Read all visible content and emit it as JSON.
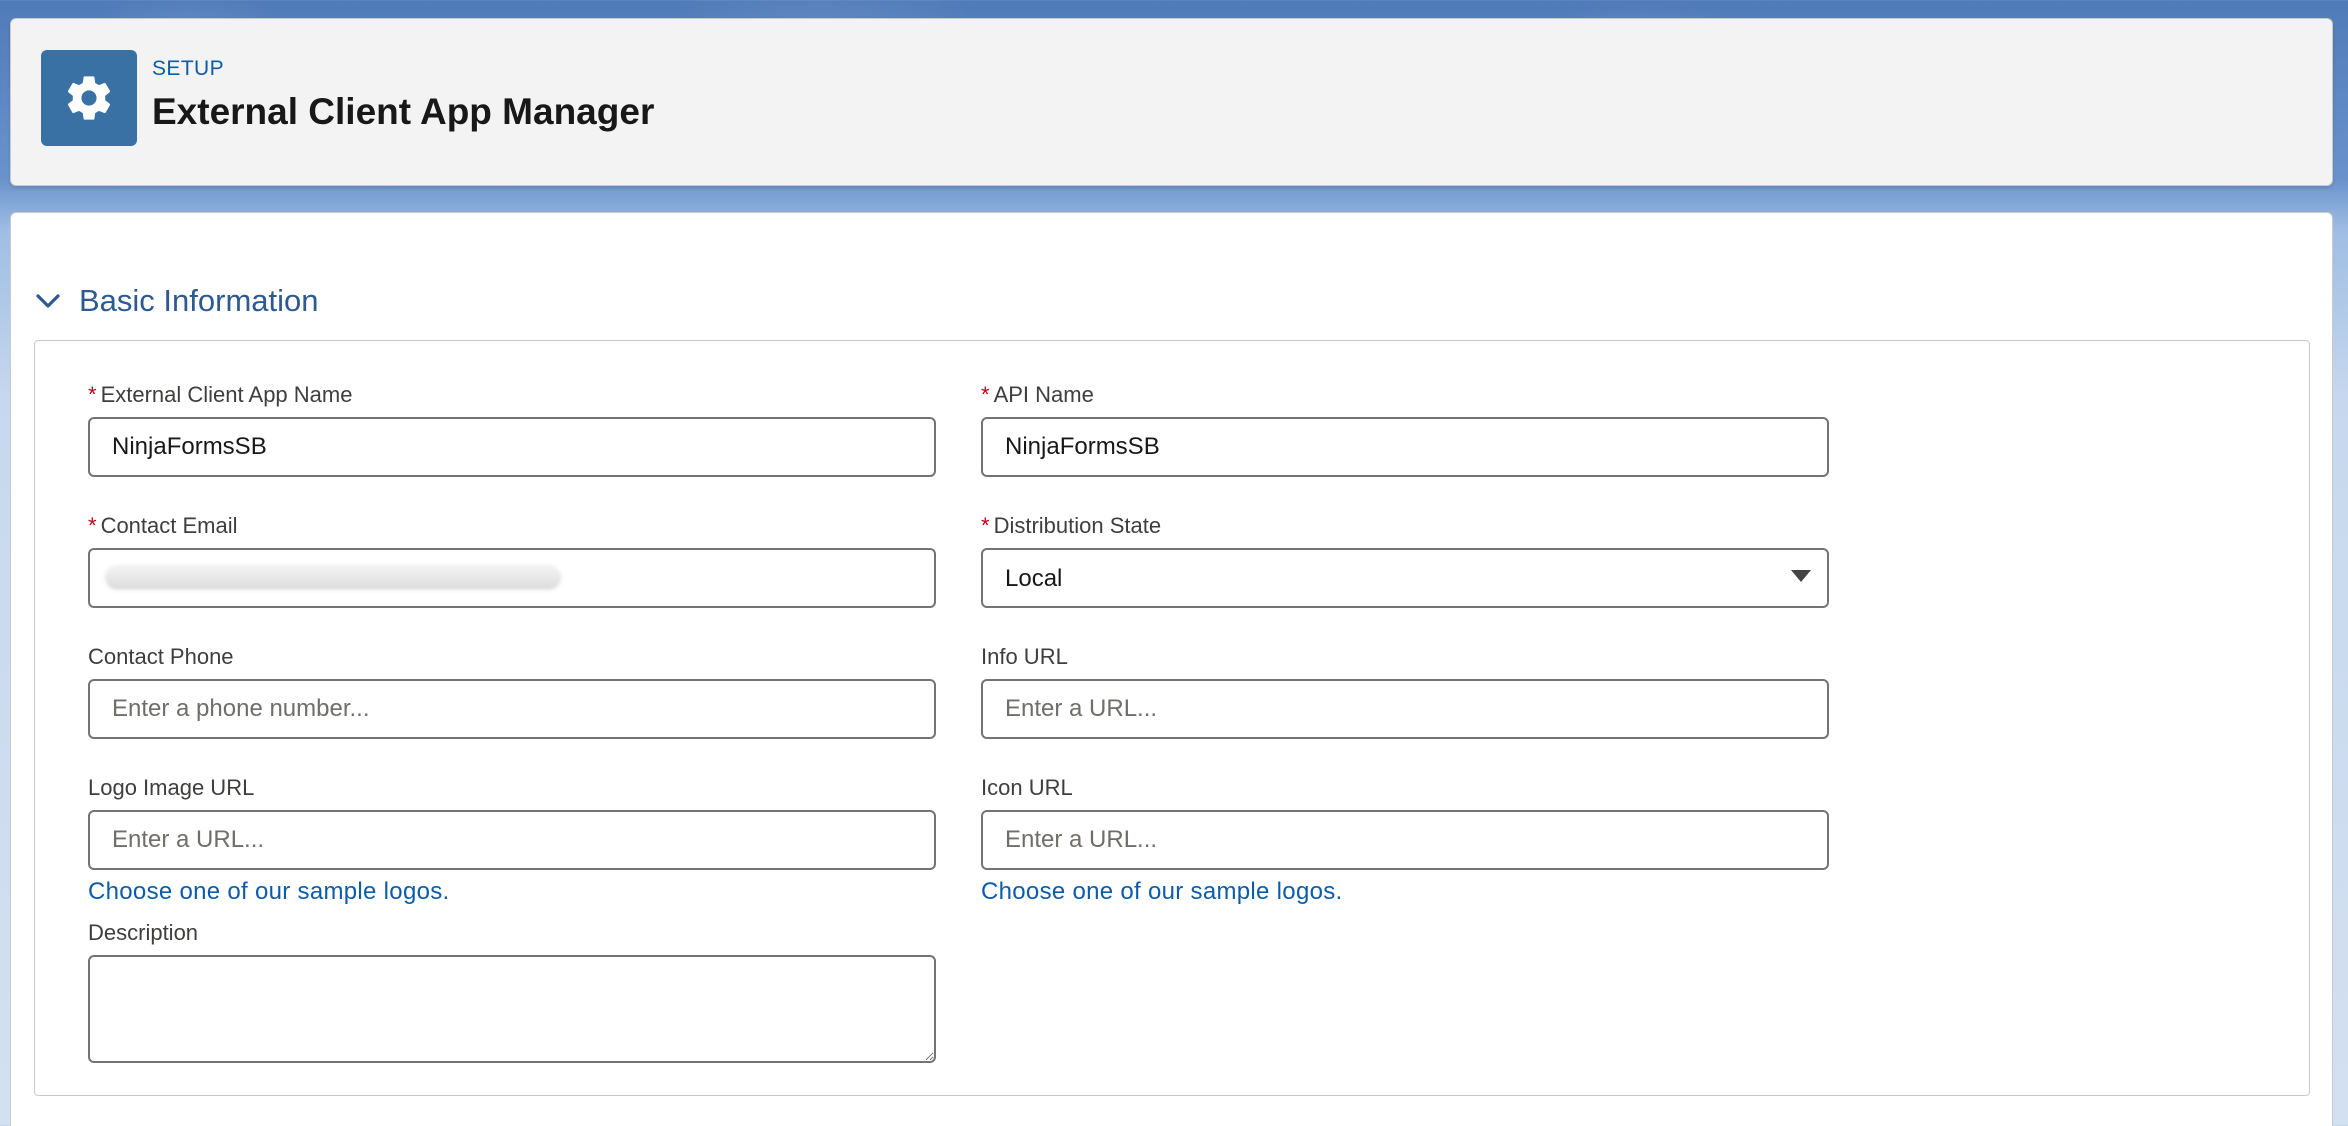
{
  "header": {
    "eyebrow": "SETUP",
    "title": "External Client App Manager",
    "icon": "gear-icon"
  },
  "section": {
    "title": "Basic Information",
    "expanded": true,
    "toggle_icon": "chevron-down-icon"
  },
  "fields": {
    "app_name": {
      "label": "External Client App Name",
      "required": "*",
      "value": "NinjaFormsSB"
    },
    "api_name": {
      "label": "API Name",
      "required": "*",
      "value": "NinjaFormsSB"
    },
    "contact_email": {
      "label": "Contact Email",
      "required": "*",
      "value": ""
    },
    "distribution_state": {
      "label": "Distribution State",
      "required": "*",
      "value": "Local",
      "options": [
        "Local"
      ]
    },
    "contact_phone": {
      "label": "Contact Phone",
      "placeholder": "Enter a phone number...",
      "value": ""
    },
    "info_url": {
      "label": "Info URL",
      "placeholder": "Enter a URL...",
      "value": ""
    },
    "logo_image_url": {
      "label": "Logo Image URL",
      "placeholder": "Enter a URL...",
      "value": "",
      "helper_link": "Choose one of our sample logos."
    },
    "icon_url": {
      "label": "Icon URL",
      "placeholder": "Enter a URL...",
      "value": "",
      "helper_link": "Choose one of our sample logos."
    },
    "description": {
      "label": "Description",
      "value": ""
    }
  },
  "colors": {
    "brand_icon_bg": "#3a71a5",
    "link": "#0b5cab",
    "required": "#ba0517",
    "section_title": "#2e5a8f"
  }
}
